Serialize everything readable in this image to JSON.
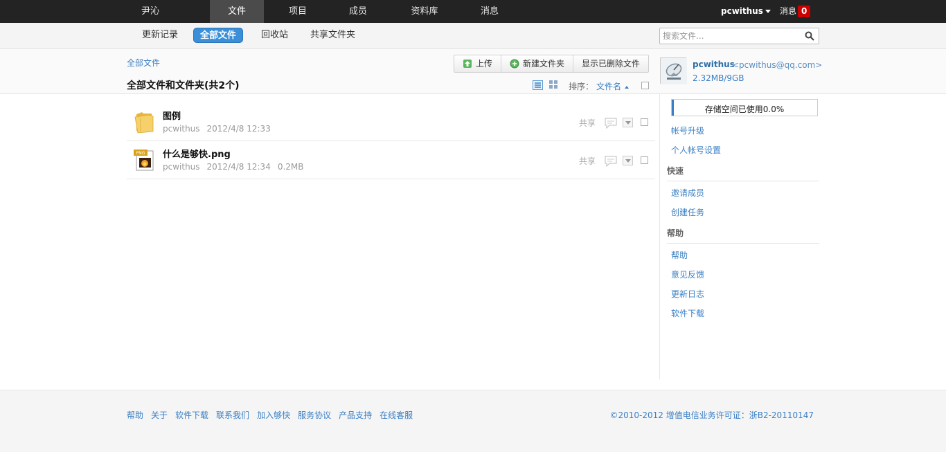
{
  "topbar": {
    "brand": "尹沁",
    "nav": [
      "文件",
      "项目",
      "成员",
      "资料库",
      "消息"
    ],
    "user": "pcwithus",
    "messages_label": "消息",
    "messages_count": "0"
  },
  "subnav": {
    "tabs": [
      "更新记录",
      "全部文件",
      "回收站",
      "共享文件夹"
    ],
    "active_tab": "全部文件",
    "search_placeholder": "搜索文件..."
  },
  "header": {
    "breadcrumb": "全部文件",
    "title": "全部文件和文件夹(共2个)",
    "toolbar": {
      "upload": "上传",
      "new_folder": "新建文件夹",
      "show_deleted": "显示已删除文件"
    },
    "sort_label": "排序：",
    "sort_value": "文件名"
  },
  "user_card": {
    "name": "pcwithus",
    "email": "<pcwithus@qq.com>",
    "usage": "2.32MB/9GB"
  },
  "files": [
    {
      "name": "图例",
      "type": "folder",
      "owner": "pcwithus",
      "date": "2012/4/8 12:33",
      "size": ""
    },
    {
      "name": "什么是够快.png",
      "type": "png",
      "owner": "pcwithus",
      "date": "2012/4/8 12:34",
      "size": "0.2MB"
    }
  ],
  "file_actions": {
    "share": "共享"
  },
  "sidebar": {
    "storage_text": "存储空间已使用0.0%",
    "storage_used_fraction": 0.0,
    "account_links": [
      "帐号升级",
      "个人帐号设置"
    ],
    "quick_heading": "快速",
    "quick_links": [
      "邀请成员",
      "创建任务"
    ],
    "help_heading": "帮助",
    "help_links": [
      "帮助",
      "意见反馈",
      "更新日志",
      "软件下载"
    ]
  },
  "footer": {
    "links": [
      "帮助",
      "关于",
      "软件下载",
      "联系我们",
      "加入够快",
      "服务协议",
      "产品支持",
      "在线客服"
    ],
    "copyright": "©2010-2012 增值电信业务许可证：浙B2-20110147"
  },
  "colors": {
    "accent": "#3a8fd8",
    "link": "#3a7fc4",
    "topbar": "#232323",
    "badge": "#cc0000"
  }
}
